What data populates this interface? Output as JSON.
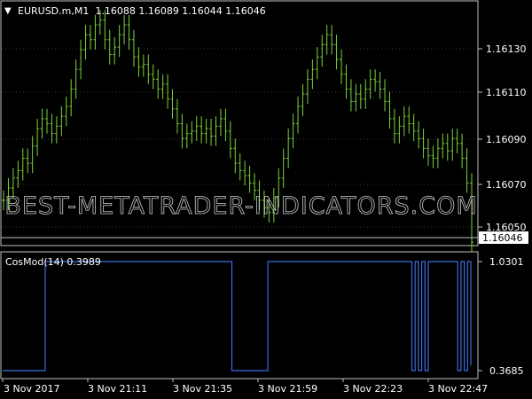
{
  "symbol_header": {
    "marker": "▼",
    "text": "EURUSD.m,M1  1.16088 1.16089 1.16044 1.16046"
  },
  "price_axis": {
    "labels": [
      "1.16130",
      "1.16110",
      "1.16090",
      "1.16070",
      "1.16050"
    ],
    "current_price": "1.16046"
  },
  "watermark": "BEST-METATRADER-INDICATORS.COM",
  "indicator": {
    "label": "CosMod(14) 0.3989",
    "labels": [
      "1.0301",
      "0.3685"
    ]
  },
  "time_axis": {
    "labels": [
      "3 Nov 2017",
      "3 Nov 21:11",
      "3 Nov 21:35",
      "3 Nov 21:59",
      "3 Nov 22:23",
      "3 Nov 22:47"
    ]
  },
  "colors": {
    "background": "#000000",
    "grid": "#c0c0c0",
    "candle": "#7cd23a",
    "indicator_line": "#3a6fe0",
    "text": "#ffffff",
    "price_tag_bg": "#ffffff",
    "price_tag_text": "#000000",
    "watermark": "#c8c8c8"
  },
  "chart_data": [
    {
      "type": "line",
      "series": [
        {
          "values": [
            1.16063,
            1.16068,
            1.16072,
            1.16075,
            1.1608,
            1.16078,
            1.16085,
            1.16092,
            1.16096,
            1.16094,
            1.1609,
            1.16093,
            1.16097,
            1.16101,
            1.16108,
            1.16116,
            1.16124,
            1.1613,
            1.16128,
            1.16134,
            1.16136,
            1.16128,
            1.16122,
            1.16125,
            1.1613,
            1.16134,
            1.16128,
            1.16121,
            1.16117,
            1.16118,
            1.16114,
            1.16112,
            1.16108,
            1.1611,
            1.16104,
            1.161,
            1.16094,
            1.16088,
            1.1609,
            1.16091,
            1.16093,
            1.1609,
            1.16092,
            1.16089,
            1.16093,
            1.16096,
            1.16091,
            1.16084,
            1.16078,
            1.16075,
            1.16073,
            1.1607,
            1.16067,
            1.16063,
            1.1606,
            1.16058,
            1.16064,
            1.16072,
            1.1608,
            1.16088,
            1.16094,
            1.16101,
            1.16106,
            1.16112,
            1.16116,
            1.16121,
            1.16126,
            1.1613,
            1.16126,
            1.1612,
            1.16114,
            1.16108,
            1.16103,
            1.16106,
            1.16104,
            1.16108,
            1.16112,
            1.16111,
            1.16108,
            1.16103,
            1.16096,
            1.1609,
            1.16093,
            1.16097,
            1.16094,
            1.16091,
            1.16088,
            1.16084,
            1.16081,
            1.1608,
            1.16084,
            1.16086,
            1.16083,
            1.16088,
            1.16086,
            1.1608,
            1.1607,
            1.16046
          ]
        }
      ],
      "ylim": [
        1.16045,
        1.16143
      ]
    },
    {
      "type": "line",
      "series": [
        {
          "values": [
            0.3685,
            0.3685,
            0.3685,
            0.3685,
            0.3685,
            0.3685,
            0.3685,
            0.3685,
            0.3685,
            0.3685,
            0.3685,
            0.3685,
            0.3685,
            1.0301,
            1.0301,
            1.0301,
            1.0301,
            1.0301,
            1.0301,
            1.0301,
            1.0301,
            1.0301,
            1.0301,
            1.0301,
            1.0301,
            1.0301,
            1.0301,
            1.0301,
            1.0301,
            1.0301,
            1.0301,
            1.0301,
            1.0301,
            1.0301,
            1.0301,
            1.0301,
            1.0301,
            1.0301,
            1.0301,
            1.0301,
            1.0301,
            1.0301,
            1.0301,
            1.0301,
            1.0301,
            1.0301,
            1.0301,
            1.0301,
            1.0301,
            1.0301,
            1.0301,
            1.0301,
            1.0301,
            1.0301,
            1.0301,
            1.0301,
            1.0301,
            1.0301,
            1.0301,
            1.0301,
            1.0301,
            1.0301,
            1.0301,
            1.0301,
            1.0301,
            1.0301,
            1.0301,
            1.0301,
            1.0301,
            1.0301,
            0.3685,
            0.3685,
            0.3685,
            0.3685,
            0.3685,
            0.3685,
            0.3685,
            0.3685,
            0.3685,
            0.3685,
            0.3685,
            1.0301,
            1.0301,
            1.0301,
            1.0301,
            1.0301,
            1.0301,
            1.0301,
            1.0301,
            1.0301,
            1.0301,
            1.0301,
            1.0301,
            1.0301,
            1.0301,
            1.0301,
            1.0301,
            1.0301,
            1.0301,
            1.0301,
            1.0301,
            1.0301,
            1.0301,
            1.0301,
            1.0301,
            1.0301,
            1.0301,
            1.0301,
            1.0301,
            1.0301,
            1.0301,
            1.0301,
            1.0301,
            1.0301,
            1.0301,
            1.0301,
            1.0301,
            1.0301,
            1.0301,
            1.0301,
            1.0301,
            1.0301,
            1.0301,
            1.0301,
            1.0301,
            0.3685,
            1.0301,
            0.3685,
            1.0301,
            0.3685,
            1.0301,
            1.0301,
            1.0301,
            1.0301,
            1.0301,
            1.0301,
            1.0301,
            1.0301,
            1.0301,
            0.3685,
            1.0301,
            0.3685,
            1.0301,
            0.3989
          ]
        }
      ],
      "ylim": [
        0.3685,
        1.0301
      ]
    }
  ]
}
